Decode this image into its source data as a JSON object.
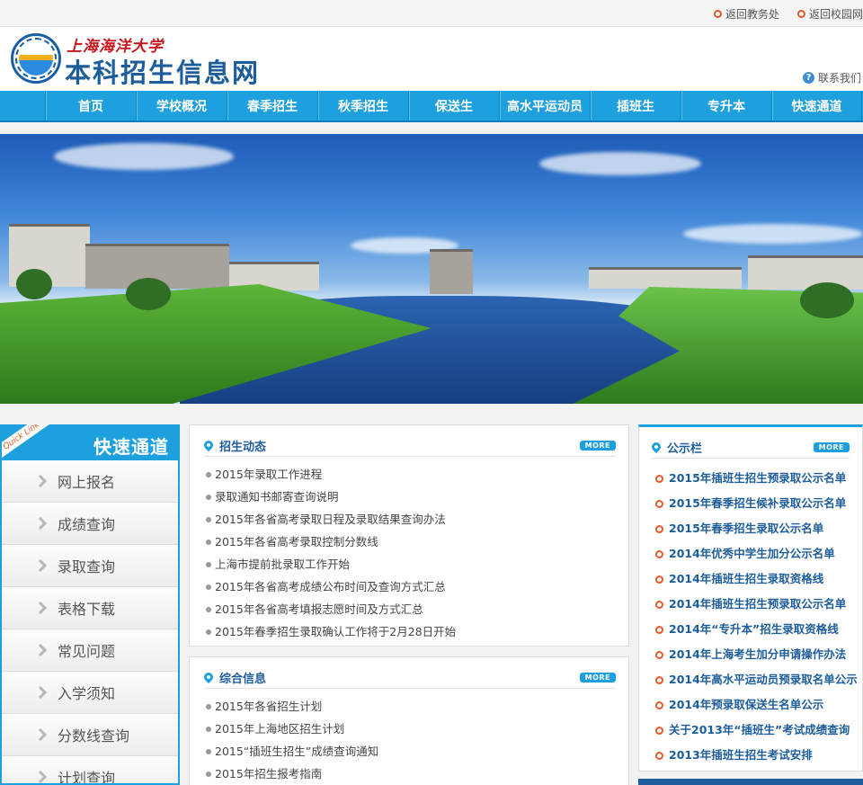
{
  "topbar": {
    "links": [
      {
        "label": "返回教务处",
        "icon": "ring-bullet-icon"
      },
      {
        "label": "返回校园网",
        "icon": "ring-bullet-icon"
      }
    ]
  },
  "header": {
    "university_name": "上海海洋大学",
    "site_title": "本科招生信息网",
    "contact_label": "联系我们",
    "contact_icon": "help-circle-icon"
  },
  "nav": {
    "items": [
      "首页",
      "学校概况",
      "春季招生",
      "秋季招生",
      "保送生",
      "高水平运动员",
      "插班生",
      "专升本",
      "快速通道"
    ]
  },
  "quick": {
    "ribbon": "Quick Link",
    "title": "快速通道",
    "items": [
      "网上报名",
      "成绩查询",
      "录取查询",
      "表格下载",
      "常见问题",
      "入学须知",
      "分数线查询",
      "计划查询"
    ]
  },
  "news": {
    "title": "招生动态",
    "more": "MORE",
    "items": [
      "2015年录取工作进程",
      "录取通知书邮寄查询说明",
      "2015年各省高考录取日程及录取结果查询办法",
      "2015年各省高考录取控制分数线",
      "上海市提前批录取工作开始",
      "2015年各省高考成绩公布时间及查询方式汇总",
      "2015年各省高考填报志愿时间及方式汇总",
      "2015年春季招生录取确认工作将于2月28日开始"
    ]
  },
  "info": {
    "title": "综合信息",
    "more": "MORE",
    "items": [
      "2015年各省招生计划",
      "2015年上海地区招生计划",
      "2015“插班生招生”成绩查询通知",
      "2015年招生报考指南"
    ]
  },
  "notice": {
    "title": "公示栏",
    "more": "MORE",
    "items": [
      "2015年插班生招生预录取公示名单",
      "2015年春季招生候补录取公示名单",
      "2015年春季招生录取公示名单",
      "2014年优秀中学生加分公示名单",
      "2014年插班生招生录取资格线",
      "2014年插班生招生预录取公示名单",
      "2014年“专升本”招生录取资格线",
      "2014年上海考生加分申请操作办法",
      "2014年高水平运动员预录取名单公示",
      "2014年预录取保送生名单公示",
      "关于2013年“插班生”考试成绩查询",
      "2013年插班生招生考试安排"
    ]
  },
  "colors": {
    "accent": "#1ea0de",
    "title_blue": "#1d5d9b",
    "bullet_orange": "#e25a2c",
    "brand_red": "#c8161d"
  }
}
